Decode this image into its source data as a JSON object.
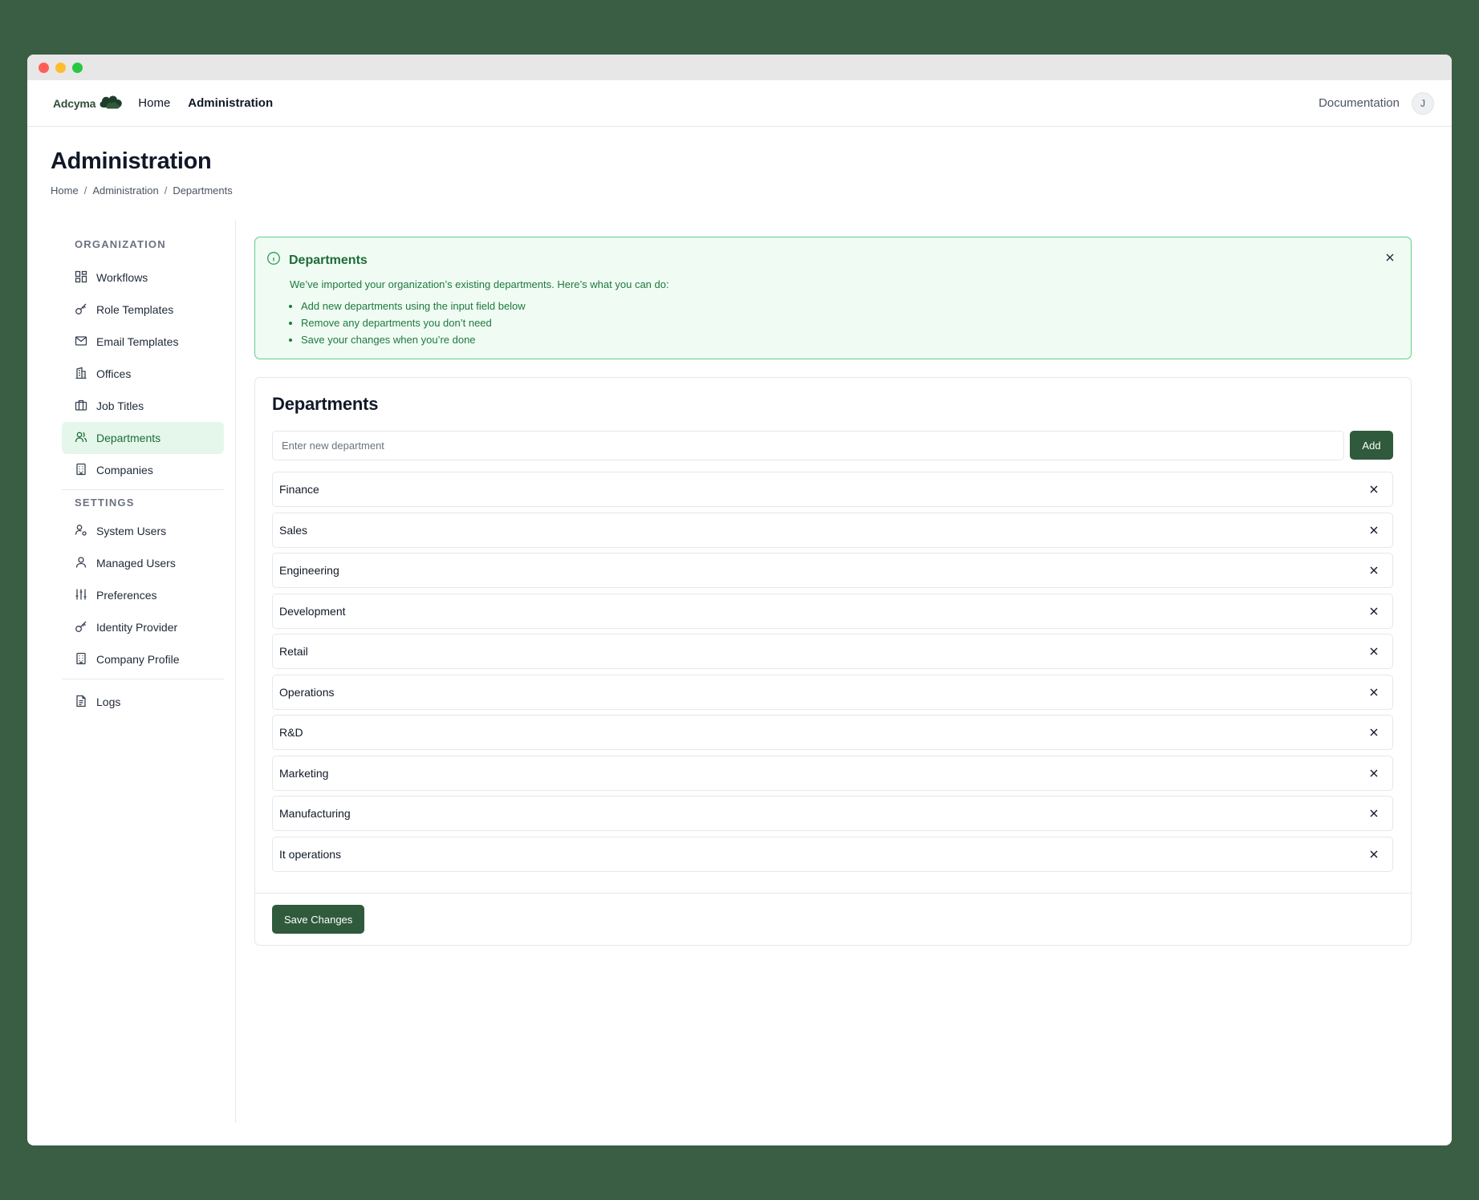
{
  "window": {
    "controls": [
      "close",
      "minimize",
      "maximize"
    ],
    "control_colors": [
      "#ff5f57",
      "#febc2e",
      "#28c840"
    ]
  },
  "topnav": {
    "brand": "Adcyma",
    "brand_icon": "cloud-icon",
    "links": [
      {
        "label": "Home",
        "active": false
      },
      {
        "label": "Administration",
        "active": true
      }
    ],
    "documentation": "Documentation",
    "avatar_initial": "J"
  },
  "header": {
    "title": "Administration",
    "breadcrumb": [
      "Home",
      "Administration",
      "Departments"
    ],
    "separator": "/"
  },
  "sidebar": {
    "organization_heading": "ORGANIZATION",
    "organization_items": [
      {
        "label": "Workflows",
        "icon": "grid-icon",
        "active": false
      },
      {
        "label": "Role Templates",
        "icon": "key-icon",
        "active": false
      },
      {
        "label": "Email Templates",
        "icon": "mail-icon",
        "active": false
      },
      {
        "label": "Offices",
        "icon": "building-icon",
        "active": false
      },
      {
        "label": "Job Titles",
        "icon": "briefcase-icon",
        "active": false
      },
      {
        "label": "Departments",
        "icon": "users-icon",
        "active": true
      },
      {
        "label": "Companies",
        "icon": "office-building-icon",
        "active": false
      }
    ],
    "settings_heading": "SETTINGS",
    "settings_items": [
      {
        "label": "System Users",
        "icon": "user-gear-icon"
      },
      {
        "label": "Managed Users",
        "icon": "user-icon"
      },
      {
        "label": "Preferences",
        "icon": "sliders-icon"
      },
      {
        "label": "Identity Provider",
        "icon": "key-icon"
      },
      {
        "label": "Company Profile",
        "icon": "office-building-icon"
      }
    ],
    "other_items": [
      {
        "label": "Logs",
        "icon": "file-text-icon"
      }
    ]
  },
  "alert": {
    "title": "Departments",
    "icon": "info-icon",
    "text": "We’ve imported your organization’s existing departments. Here’s what you can do:",
    "bullets": [
      "Add new departments using the input field below",
      "Remove any departments you don’t need",
      "Save your changes when you’re done"
    ]
  },
  "card": {
    "title": "Departments",
    "input_placeholder": "Enter new department",
    "input_value": "",
    "add_label": "Add",
    "departments": [
      "Finance",
      "Sales",
      "Engineering",
      "Development",
      "Retail",
      "Operations",
      "R&D",
      "Marketing",
      "Manufacturing",
      "It operations"
    ],
    "save_label": "Save Changes"
  },
  "colors": {
    "background": "#3a5e44",
    "primary_button": "#2f5a3c",
    "alert_border": "#5fce88",
    "alert_background": "#effbf3",
    "active_nav_background": "#e4f7ea"
  }
}
